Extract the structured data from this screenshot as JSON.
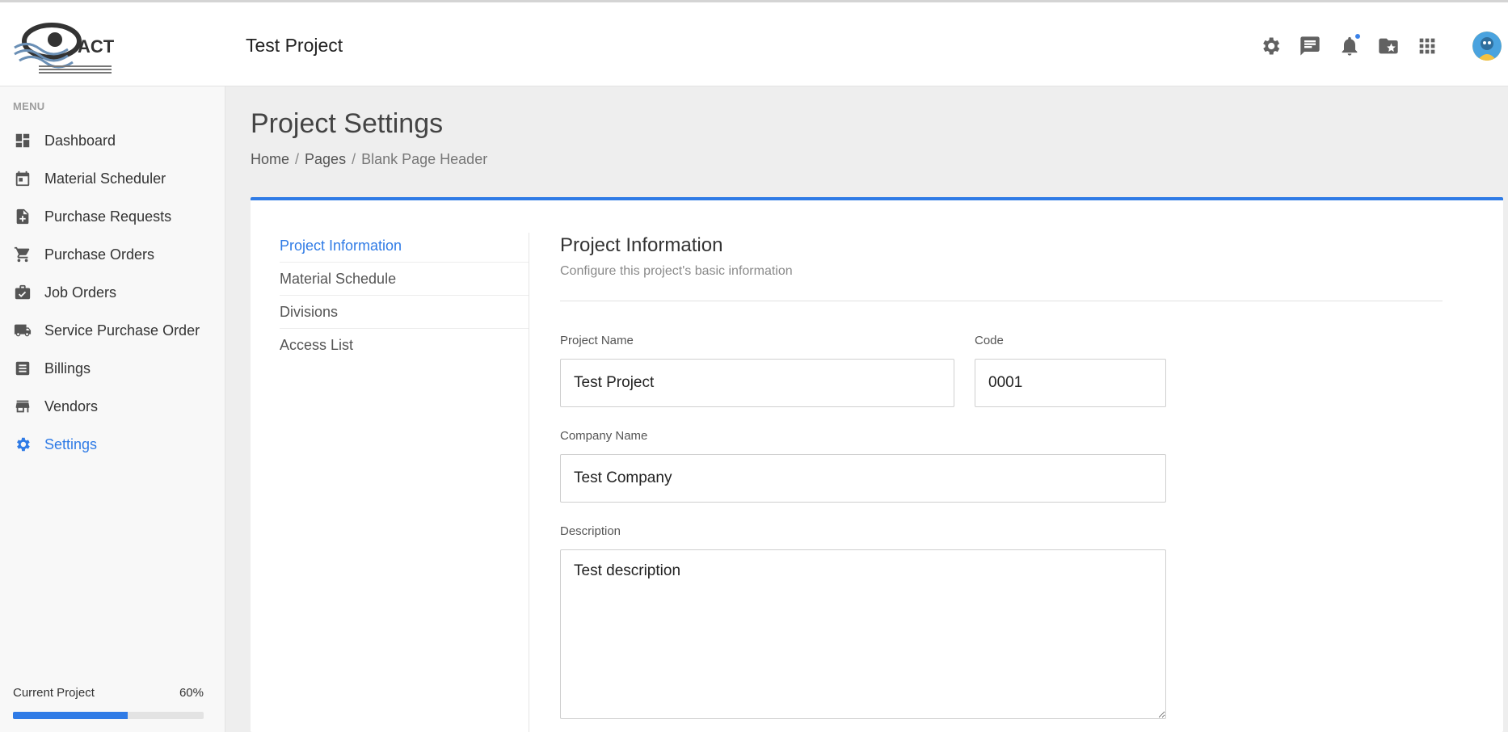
{
  "header": {
    "logo_text": "ACT",
    "logo_subtext": "AC TRANSIENT CONSTRUCTION BUILDERS AND DEVELOPMENT CORP.",
    "project_title": "Test Project",
    "icons": [
      "gear-icon",
      "chat-icon",
      "bell-icon",
      "folder-star-icon",
      "apps-grid-icon"
    ],
    "accent_color": "#2f7be6"
  },
  "sidebar": {
    "menu_label": "MENU",
    "items": [
      {
        "label": "Dashboard",
        "icon": "dashboard-icon"
      },
      {
        "label": "Material Scheduler",
        "icon": "calendar-icon"
      },
      {
        "label": "Purchase Requests",
        "icon": "file-plus-icon"
      },
      {
        "label": "Purchase Orders",
        "icon": "cart-icon"
      },
      {
        "label": "Job Orders",
        "icon": "briefcase-check-icon"
      },
      {
        "label": "Service Purchase Order",
        "icon": "truck-icon"
      },
      {
        "label": "Billings",
        "icon": "receipt-icon"
      },
      {
        "label": "Vendors",
        "icon": "store-icon"
      },
      {
        "label": "Settings",
        "icon": "gear-icon",
        "active": true
      }
    ],
    "current_project": {
      "label": "Current Project",
      "percent_text": "60%",
      "progress_fraction": 0.6
    }
  },
  "page": {
    "title": "Project Settings",
    "breadcrumb": [
      "Home",
      "Pages",
      "Blank Page Header"
    ]
  },
  "settings_nav": [
    {
      "label": "Project Information",
      "active": true
    },
    {
      "label": "Material Schedule"
    },
    {
      "label": "Divisions"
    },
    {
      "label": "Access List"
    }
  ],
  "section": {
    "title": "Project Information",
    "subtitle": "Configure this project's basic information"
  },
  "form": {
    "project_name": {
      "label": "Project Name",
      "value": "Test Project"
    },
    "code": {
      "label": "Code",
      "value": "0001"
    },
    "company_name": {
      "label": "Company Name",
      "value": "Test Company"
    },
    "description": {
      "label": "Description",
      "value": "Test description"
    }
  }
}
